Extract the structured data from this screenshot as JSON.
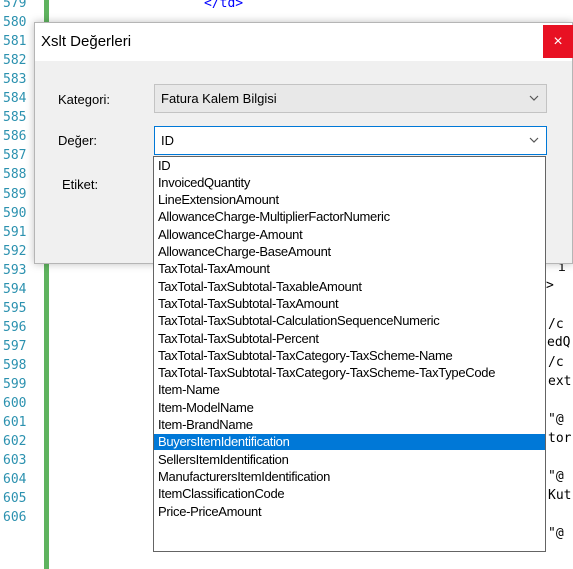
{
  "editor": {
    "line_numbers": [
      "579",
      "580",
      "581",
      "582",
      "583",
      "584",
      "585",
      "586",
      "587",
      "588",
      "589",
      "590",
      "591",
      "592",
      "593",
      "594",
      "595",
      "596",
      "597",
      "598",
      "599",
      "600",
      "601",
      "602",
      "603",
      "604",
      "605",
      "606"
    ],
    "code_fragments": {
      "top_tag": "</td>",
      "l591": "i",
      "l592": ">",
      "l594": "/c",
      "l595": "edQ",
      "l596": "/c",
      "l597": "ext",
      "l599": "\"@",
      "l600": "tor",
      "l602": "\"@",
      "l603": "Kut",
      "l605": "\"@"
    }
  },
  "dialog": {
    "title": "Xslt Değerleri",
    "close_label": "×",
    "category_label": "Kategori:",
    "category_value": "Fatura Kalem Bilgisi",
    "value_label": "Değer:",
    "value_value": "ID",
    "tag_label": "Etiket:"
  },
  "dropdown": {
    "selected_index": 17,
    "options": [
      "ID",
      "InvoicedQuantity",
      "LineExtensionAmount",
      "AllowanceCharge-MultiplierFactorNumeric",
      "AllowanceCharge-Amount",
      "AllowanceCharge-BaseAmount",
      "TaxTotal-TaxAmount",
      "TaxTotal-TaxSubtotal-TaxableAmount",
      "TaxTotal-TaxSubtotal-TaxAmount",
      "TaxTotal-TaxSubtotal-CalculationSequenceNumeric",
      "TaxTotal-TaxSubtotal-Percent",
      "TaxTotal-TaxSubtotal-TaxCategory-TaxScheme-Name",
      "TaxTotal-TaxSubtotal-TaxCategory-TaxScheme-TaxTypeCode",
      "Item-Name",
      "Item-ModelName",
      "Item-BrandName",
      "BuyersItemIdentification",
      "SellersItemIdentification",
      "ManufacturersItemIdentification",
      "ItemClassificationCode",
      "Price-PriceAmount"
    ]
  },
  "colors": {
    "line_number": "#2b91af",
    "fold_bar": "#5fb35f",
    "close_button": "#e81123",
    "selection": "#0078d7"
  }
}
